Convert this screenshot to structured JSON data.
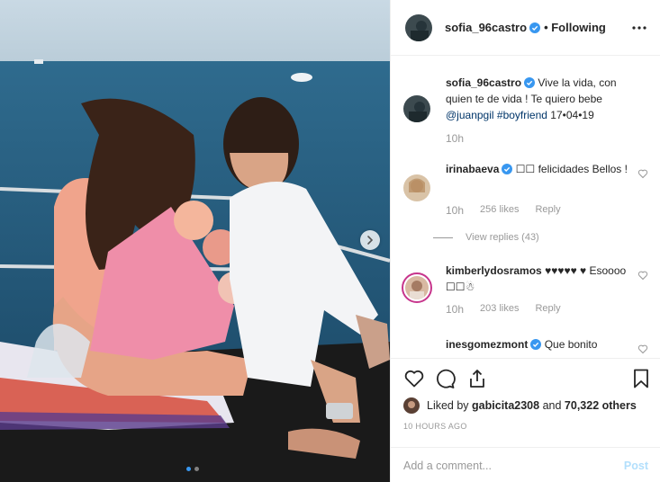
{
  "post": {
    "author": "sofia_96castro",
    "following_label": "• Following",
    "caption": {
      "username": "sofia_96castro",
      "text": "Vive la vida, con quien te de vida ! Te quiero bebe",
      "mention": "@juanpgil",
      "hashtag": "#boyfriend",
      "date_text": "17•04•19",
      "time": "10h"
    },
    "carousel": {
      "total": 2,
      "active": 1
    }
  },
  "comments": [
    {
      "username": "irinabaeva",
      "text": "☐☐ felicidades Bellos !",
      "time": "10h",
      "likes": "256 likes",
      "reply": "Reply",
      "view_replies": "View replies (43)"
    },
    {
      "username": "kimberlydosramos",
      "text": "♥♥♥♥♥ ♥ Esoooo ☐☐☃",
      "time": "10h",
      "likes": "203 likes",
      "reply": "Reply"
    },
    {
      "username": "inesgomezmont",
      "text": "Que bonito",
      "time": "",
      "likes": "",
      "reply": ""
    }
  ],
  "footer": {
    "liked_prefix": "Liked by",
    "liked_user": "gabicita2308",
    "liked_suffix": "and",
    "others": "70,322 others",
    "time_ago": "10 HOURS AGO",
    "comment_placeholder": "Add a comment...",
    "post_label": "Post"
  },
  "icons": {
    "verified": "verified-badge-icon",
    "more": "more-options-icon",
    "like": "heart-icon",
    "comment": "comment-icon",
    "share": "share-icon",
    "save": "bookmark-icon",
    "next": "chevron-right-icon"
  },
  "colors": {
    "verified": "#3897f0",
    "link": "#003569",
    "muted": "#999999",
    "post_disabled": "#b2dffc"
  }
}
